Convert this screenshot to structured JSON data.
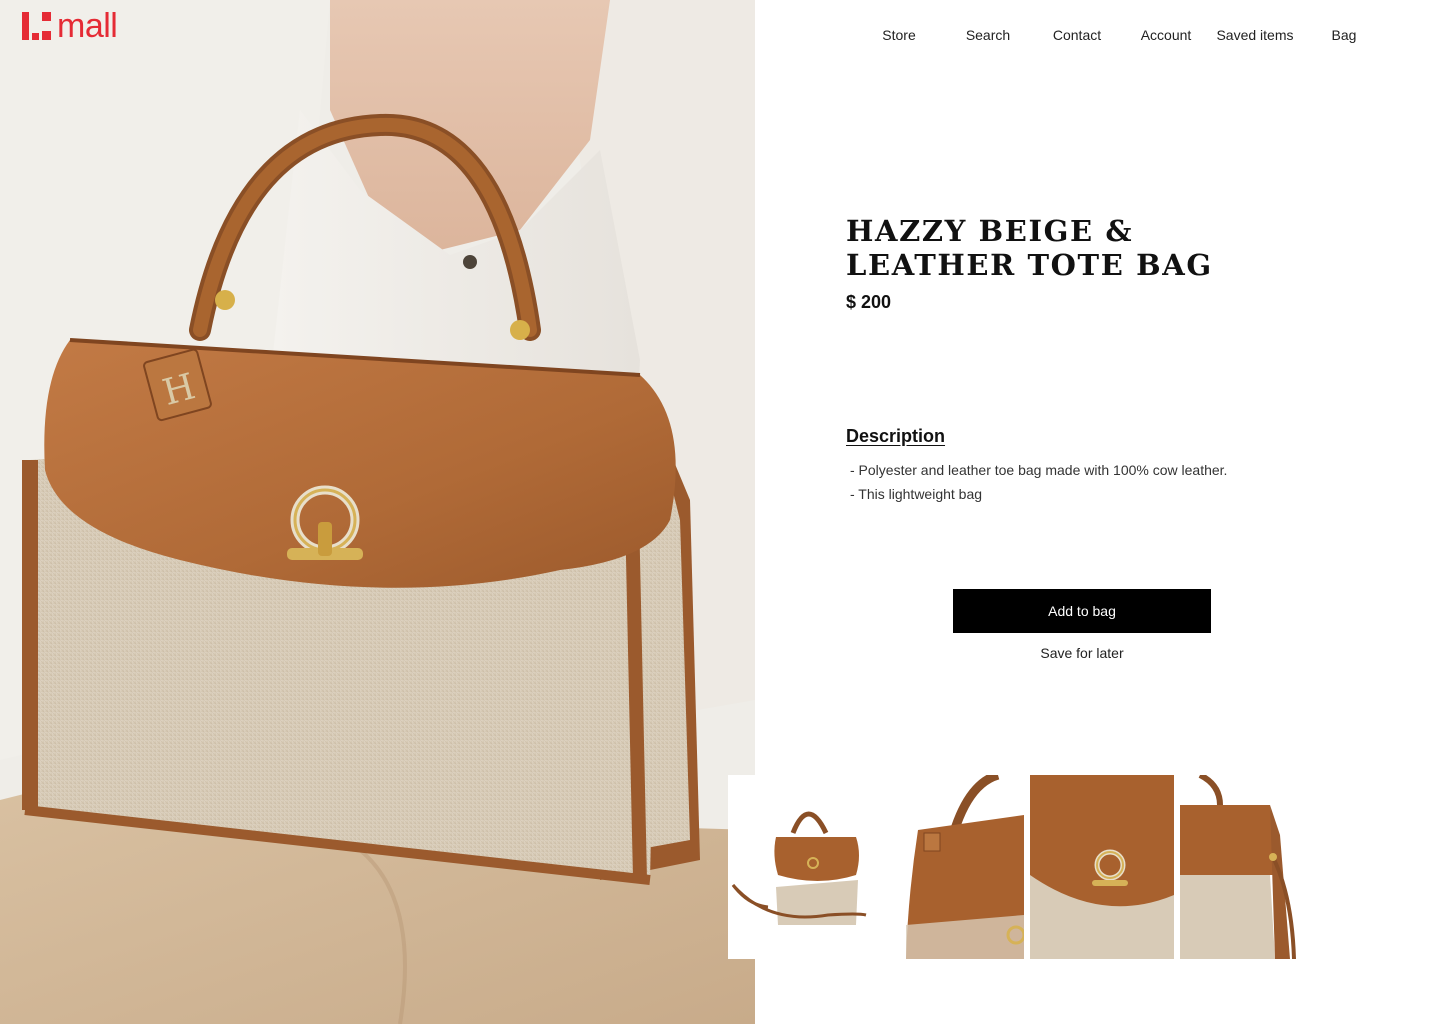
{
  "brand": {
    "logo_text": "mall"
  },
  "nav": {
    "items": [
      {
        "label": "Store"
      },
      {
        "label": "Search"
      },
      {
        "label": "Contact"
      },
      {
        "label": "Account"
      },
      {
        "label": "Saved items"
      },
      {
        "label": "Bag"
      }
    ]
  },
  "product": {
    "title": "HAZZY BEIGE & LEATHER TOTE BAG",
    "price": "$ 200",
    "description_heading": "Description",
    "description_lines": [
      "- Polyester and leather toe bag made with 100% cow leather.",
      "- This lightweight bag"
    ],
    "add_to_bag_label": "Add to bag",
    "save_for_later_label": "Save for later"
  },
  "colors": {
    "brand_red": "#e52b35",
    "leather_brown": "#a8612e",
    "canvas_beige": "#d8cbb7",
    "button_black": "#000000"
  },
  "thumbnails": [
    {
      "name": "full-bag-with-strap"
    },
    {
      "name": "flap-detail"
    },
    {
      "name": "clasp-closeup"
    },
    {
      "name": "side-view"
    }
  ]
}
